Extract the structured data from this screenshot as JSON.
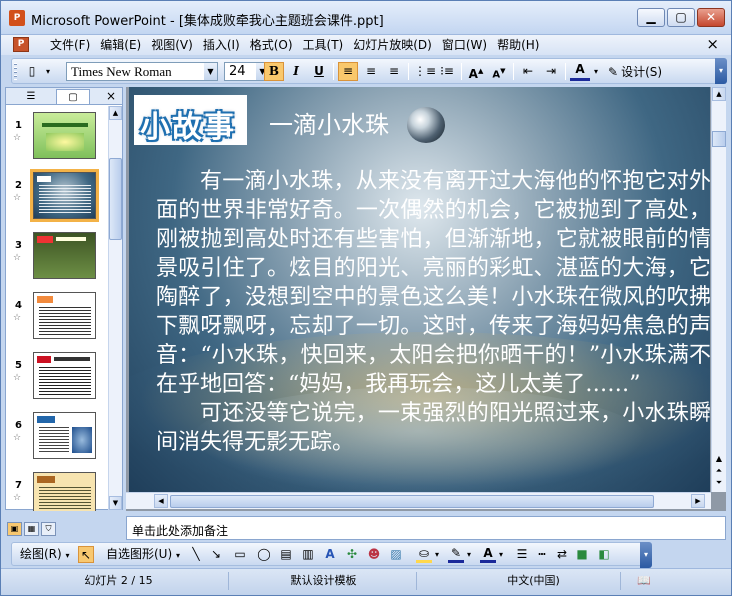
{
  "window": {
    "title": "Microsoft PowerPoint - [集体成败牵我心主题班会课件.ppt]",
    "app_icon": "P",
    "minimize_icon": "minimize-icon",
    "maximize_icon": "maximize-icon",
    "close_icon": "close-icon"
  },
  "menu": {
    "doc_icon": "P",
    "items": [
      "文件(F)",
      "编辑(E)",
      "视图(V)",
      "插入(I)",
      "格式(O)",
      "工具(T)",
      "幻灯片放映(D)",
      "窗口(W)",
      "帮助(H)"
    ],
    "close_glyph": "×"
  },
  "toolbar": {
    "font_name": "Times New Roman",
    "font_size": "24",
    "bold": "B",
    "italic": "I",
    "underline": "U",
    "design_label": "设计(S)"
  },
  "left_panel": {
    "close_glyph": "×",
    "selected_slide": 2,
    "slides": [
      {
        "number": "1"
      },
      {
        "number": "2"
      },
      {
        "number": "3"
      },
      {
        "number": "4"
      },
      {
        "number": "5"
      },
      {
        "number": "6"
      },
      {
        "number": "7"
      }
    ]
  },
  "slide": {
    "logo_text": "小故事",
    "title": "一滴小水珠",
    "paragraph1": "有一滴小水珠，从来没有离开过大海他的怀抱它对外面的世界非常好奇。一次偶然的机会，它被抛到了高处，刚被抛到高处时还有些害怕，但渐渐地，它就被眼前的情景吸引住了。炫目的阳光、亮丽的彩虹、湛蓝的大海，它陶醉了，没想到空中的景色这么美！小水珠在微风的吹拂下飘呀飘呀，忘却了一切。这时，传来了海妈妈焦急的声音：“小水珠，快回来，太阳会把你晒干的！”小水珠满不在乎地回答：“妈妈，我再玩会，这儿太美了……”",
    "paragraph2": "可还没等它说完，一束强烈的阳光照过来，小水珠瞬间消失得无影无踪。"
  },
  "notes": {
    "placeholder": "单击此处添加备注"
  },
  "draw_toolbar": {
    "draw_label": "绘图(R)",
    "autoshapes_label": "自选图形(U)"
  },
  "status": {
    "slide_counter": "幻灯片 2 / 15",
    "design_template": "默认设计模板",
    "language": "中文(中国)"
  }
}
